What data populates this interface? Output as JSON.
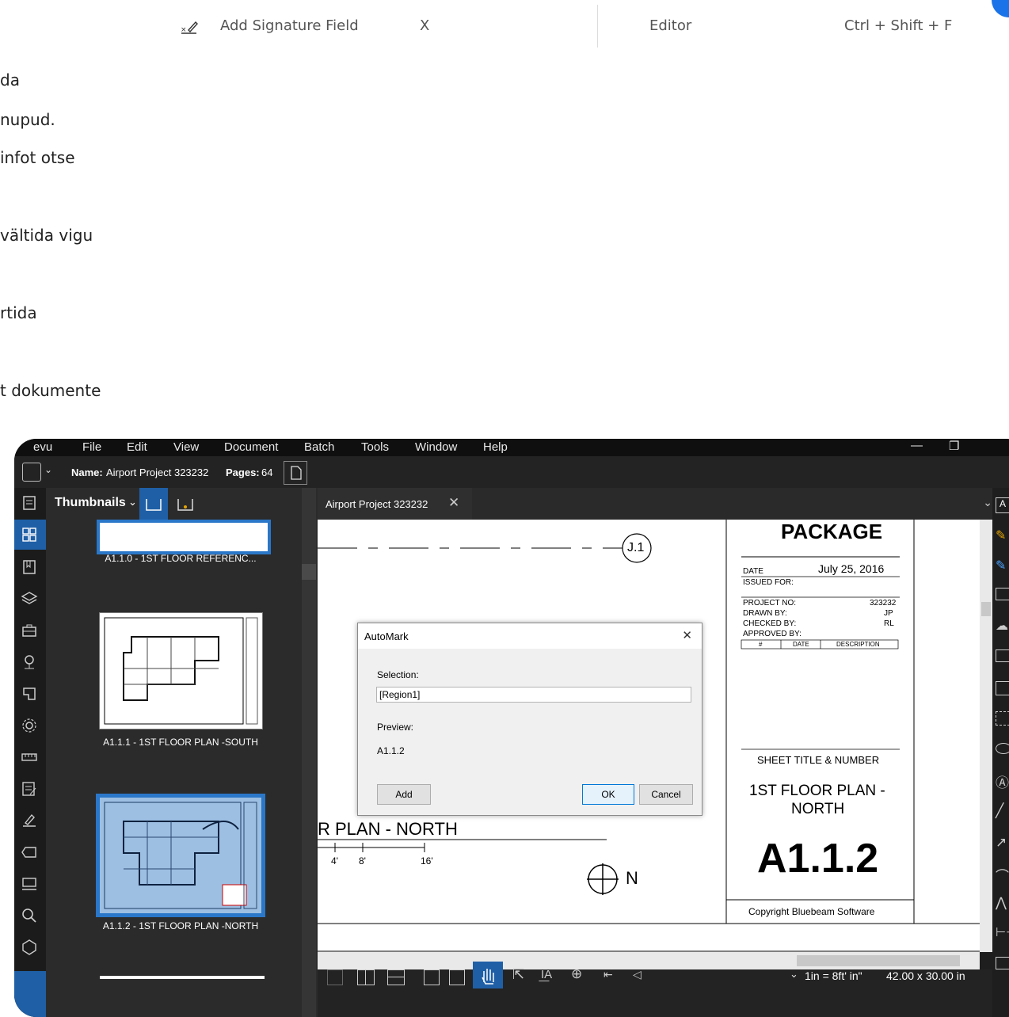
{
  "shortcut_row": {
    "field_label": "Add Signature Field",
    "field_key": "X",
    "category": "Editor",
    "shortcut": "Ctrl + Shift + F"
  },
  "paragraph_lines": [
    "da",
    "nupud.",
    "infot otse",
    "vältida vigu",
    "rtida",
    "t dokumente"
  ],
  "app": {
    "menu": [
      "evu",
      "File",
      "Edit",
      "View",
      "Document",
      "Batch",
      "Tools",
      "Window",
      "Help"
    ],
    "name_label": "Name:",
    "name_value": "Airport Project 323232",
    "pages_label": "Pages:",
    "pages_value": "64",
    "panel_title": "Thumbnails",
    "thumbnails": [
      {
        "label": "A1.1.0 - 1ST FLOOR REFERENC..."
      },
      {
        "label": "A1.1.1 - 1ST FLOOR PLAN -SOUTH"
      },
      {
        "label": "A1.1.2 - 1ST FLOOR PLAN -NORTH"
      }
    ],
    "tab_title": "Airport Project 323232",
    "tab_close": "✕",
    "drawing": {
      "grid_bubble": "J.1",
      "plan_title": "R PLAN - NORTH",
      "scale_ticks": [
        "4'",
        "8'",
        "16'"
      ],
      "north": "N"
    },
    "titleblock": {
      "package": "PACKAGE",
      "date_label": "DATE",
      "date_value": "July 25, 2016",
      "issued_for": "ISSUED FOR:",
      "project_no_label": "PROJECT NO:",
      "project_no_value": "323232",
      "drawn_by_label": "DRAWN BY:",
      "drawn_by_value": "JP",
      "checked_by_label": "CHECKED BY:",
      "checked_by_value": "RL",
      "approved_by_label": "APPROVED BY:",
      "rev_cols": [
        "#",
        "DATE",
        "DESCRIPTION"
      ],
      "sheet_title_label": "SHEET TITLE & NUMBER",
      "sheet_title_line1": "1ST FLOOR PLAN -",
      "sheet_title_line2": "NORTH",
      "sheet_number": "A1.1.2",
      "copyright": "Copyright Bluebeam Software"
    },
    "dialog": {
      "title": "AutoMark",
      "close": "✕",
      "selection_label": "Selection:",
      "selection_value": "[Region1]",
      "preview_label": "Preview:",
      "preview_value": "A1.1.2",
      "add": "Add",
      "ok": "OK",
      "cancel": "Cancel"
    },
    "status": {
      "scale": "1in = 8ft' in\"",
      "size": "42.00 x 30.00 in"
    },
    "colors": {
      "accent": "#1f5fa6",
      "selection": "#9dbfe2"
    }
  }
}
